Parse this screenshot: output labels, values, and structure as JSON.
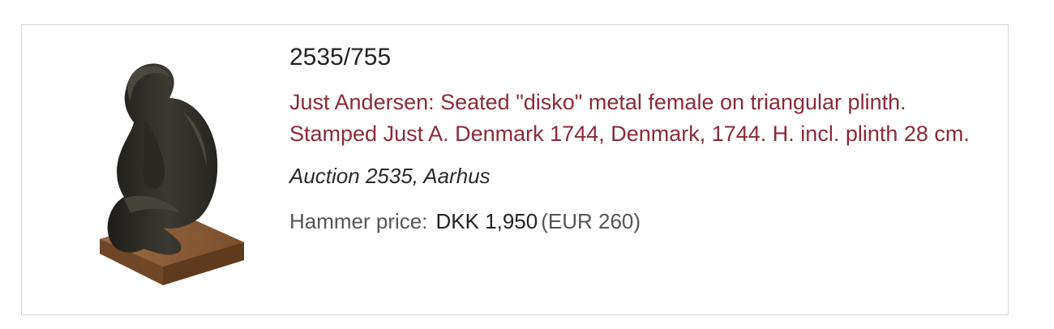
{
  "lot": {
    "number": "2535/755",
    "title": "Just Andersen: Seated \"disko\" metal female on triangular plinth. Stamped Just A. Denmark 1744, Denmark, 1744. H. incl. plinth 28 cm.",
    "auction": "Auction 2535, Aarhus",
    "price_label": "Hammer price:",
    "price_dkk": "DKK 1,950",
    "price_eur": "(EUR 260)"
  },
  "image": {
    "icon": "sculpture-photo",
    "colors": {
      "bronze": "#2f2d27",
      "plinth": "#8a5a35"
    }
  },
  "colors": {
    "title": "#8b2a3a",
    "border": "#d6d6d6"
  }
}
